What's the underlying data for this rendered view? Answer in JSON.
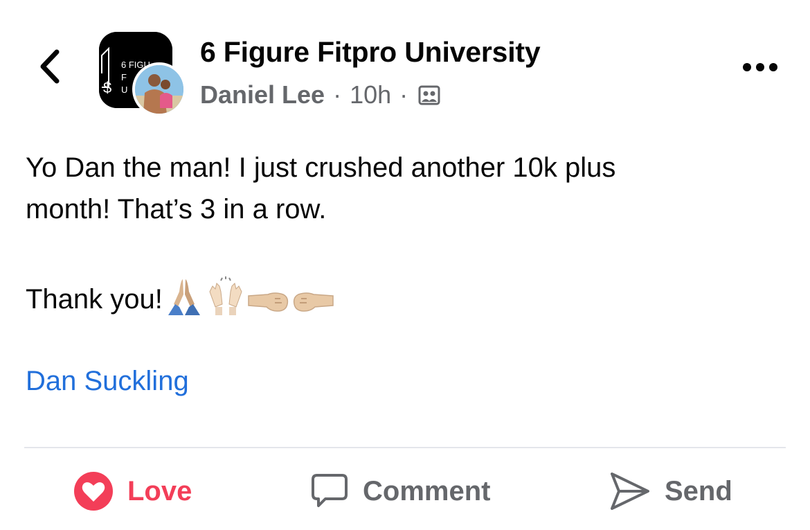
{
  "header": {
    "group_name": "6 Figure Fitpro University",
    "author": "Daniel Lee",
    "separator": "·",
    "time": "10h",
    "audience_icon": "group-audience-icon",
    "group_logo_lines": [
      "6 FIGU",
      "F",
      "U"
    ]
  },
  "post": {
    "text_line1": "Yo Dan the man! I just crushed another 10k plus",
    "text_line2": "month! That’s 3 in a row.",
    "thanks_text": "Thank you!",
    "emojis": [
      "folded-hands-emoji",
      "raising-hands-emoji",
      "left-facing-fist-emoji",
      "right-facing-fist-emoji"
    ],
    "mention": "Dan Suckling"
  },
  "actions": {
    "love_label": "Love",
    "comment_label": "Comment",
    "send_label": "Send"
  },
  "colors": {
    "love": "#f33e58",
    "link": "#216fdb",
    "secondary_text": "#65676b",
    "primary_text": "#050505",
    "divider": "#e4e6eb"
  }
}
